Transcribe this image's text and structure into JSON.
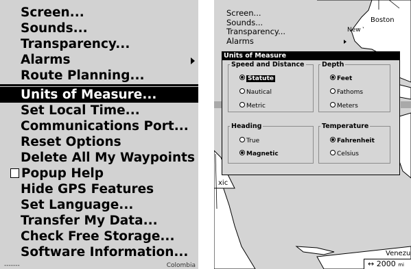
{
  "left_menu": {
    "items": [
      {
        "label": "Screen...",
        "type": "normal"
      },
      {
        "label": "Sounds...",
        "type": "normal"
      },
      {
        "label": "Transparency...",
        "type": "normal"
      },
      {
        "label": "Alarms",
        "type": "submenu"
      },
      {
        "label": "Route Planning...",
        "type": "normal"
      },
      {
        "label": "Units of Measure...",
        "type": "selected"
      },
      {
        "label": "Set Local Time...",
        "type": "normal"
      },
      {
        "label": "Communications Port...",
        "type": "normal"
      },
      {
        "label": "Reset Options",
        "type": "normal"
      },
      {
        "label": "Delete All My Waypoints",
        "type": "normal"
      },
      {
        "label": "Popup Help",
        "type": "checkbox",
        "checked": false
      },
      {
        "label": "Hide GPS Features",
        "type": "normal"
      },
      {
        "label": "Set Language...",
        "type": "normal"
      },
      {
        "label": "Transfer My Data...",
        "type": "normal"
      },
      {
        "label": "Check Free Storage...",
        "type": "normal"
      },
      {
        "label": "Software Information...",
        "type": "normal"
      }
    ],
    "bottom_fragments": [
      "-------",
      "Colombia"
    ]
  },
  "right_panel": {
    "small_menu": [
      {
        "label": "Screen..."
      },
      {
        "label": "Sounds..."
      },
      {
        "label": "Transparency..."
      },
      {
        "label": "Alarms",
        "submenu": true
      }
    ],
    "map_labels": {
      "boston": "Boston",
      "new_york": "New York",
      "mexico_fragment": "xic",
      "venezuela_fragment": "Venezu"
    },
    "dialog": {
      "title": "Units of Measure",
      "speed_distance": {
        "title": "Speed and Distance",
        "options": [
          {
            "label": "Statute",
            "selected": true,
            "highlighted": true
          },
          {
            "label": "Nautical",
            "selected": false
          },
          {
            "label": "Metric",
            "selected": false
          }
        ]
      },
      "depth": {
        "title": "Depth",
        "options": [
          {
            "label": "Feet",
            "selected": true
          },
          {
            "label": "Fathoms",
            "selected": false
          },
          {
            "label": "Meters",
            "selected": false
          }
        ]
      },
      "heading": {
        "title": "Heading",
        "options": [
          {
            "label": "True",
            "selected": false
          },
          {
            "label": "Magnetic",
            "selected": true
          }
        ]
      },
      "temperature": {
        "title": "Temperature",
        "options": [
          {
            "label": "Fahrenheit",
            "selected": true
          },
          {
            "label": "Celsius",
            "selected": false
          }
        ]
      }
    },
    "scale": {
      "arrow": "↔",
      "value": "2000",
      "unit": "mi"
    }
  }
}
